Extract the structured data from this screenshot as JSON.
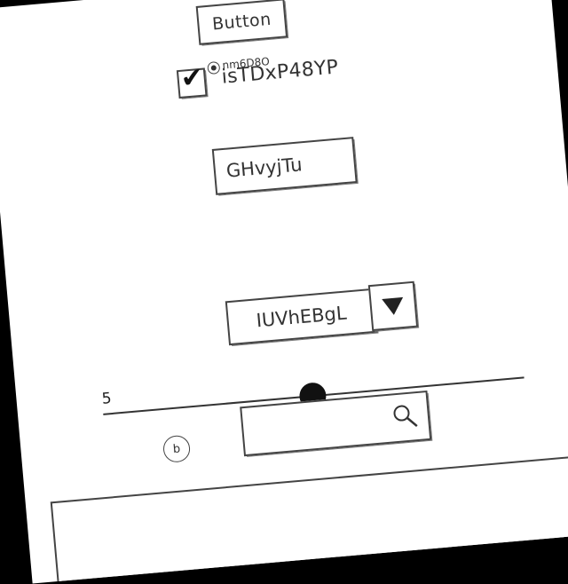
{
  "toolbar": {
    "button_label": "Button"
  },
  "checkbox": {
    "checked": true,
    "small_label": "nm6D8O",
    "label": "isTDxP48YP"
  },
  "text_input": {
    "value": "GHvyjTu"
  },
  "combo": {
    "value": "IUVhEBgL"
  },
  "slider": {
    "value": "5"
  },
  "radio_small": {
    "label": "b"
  },
  "search": {
    "value": "",
    "icon": "search-icon"
  },
  "text_area": {
    "value": ""
  }
}
